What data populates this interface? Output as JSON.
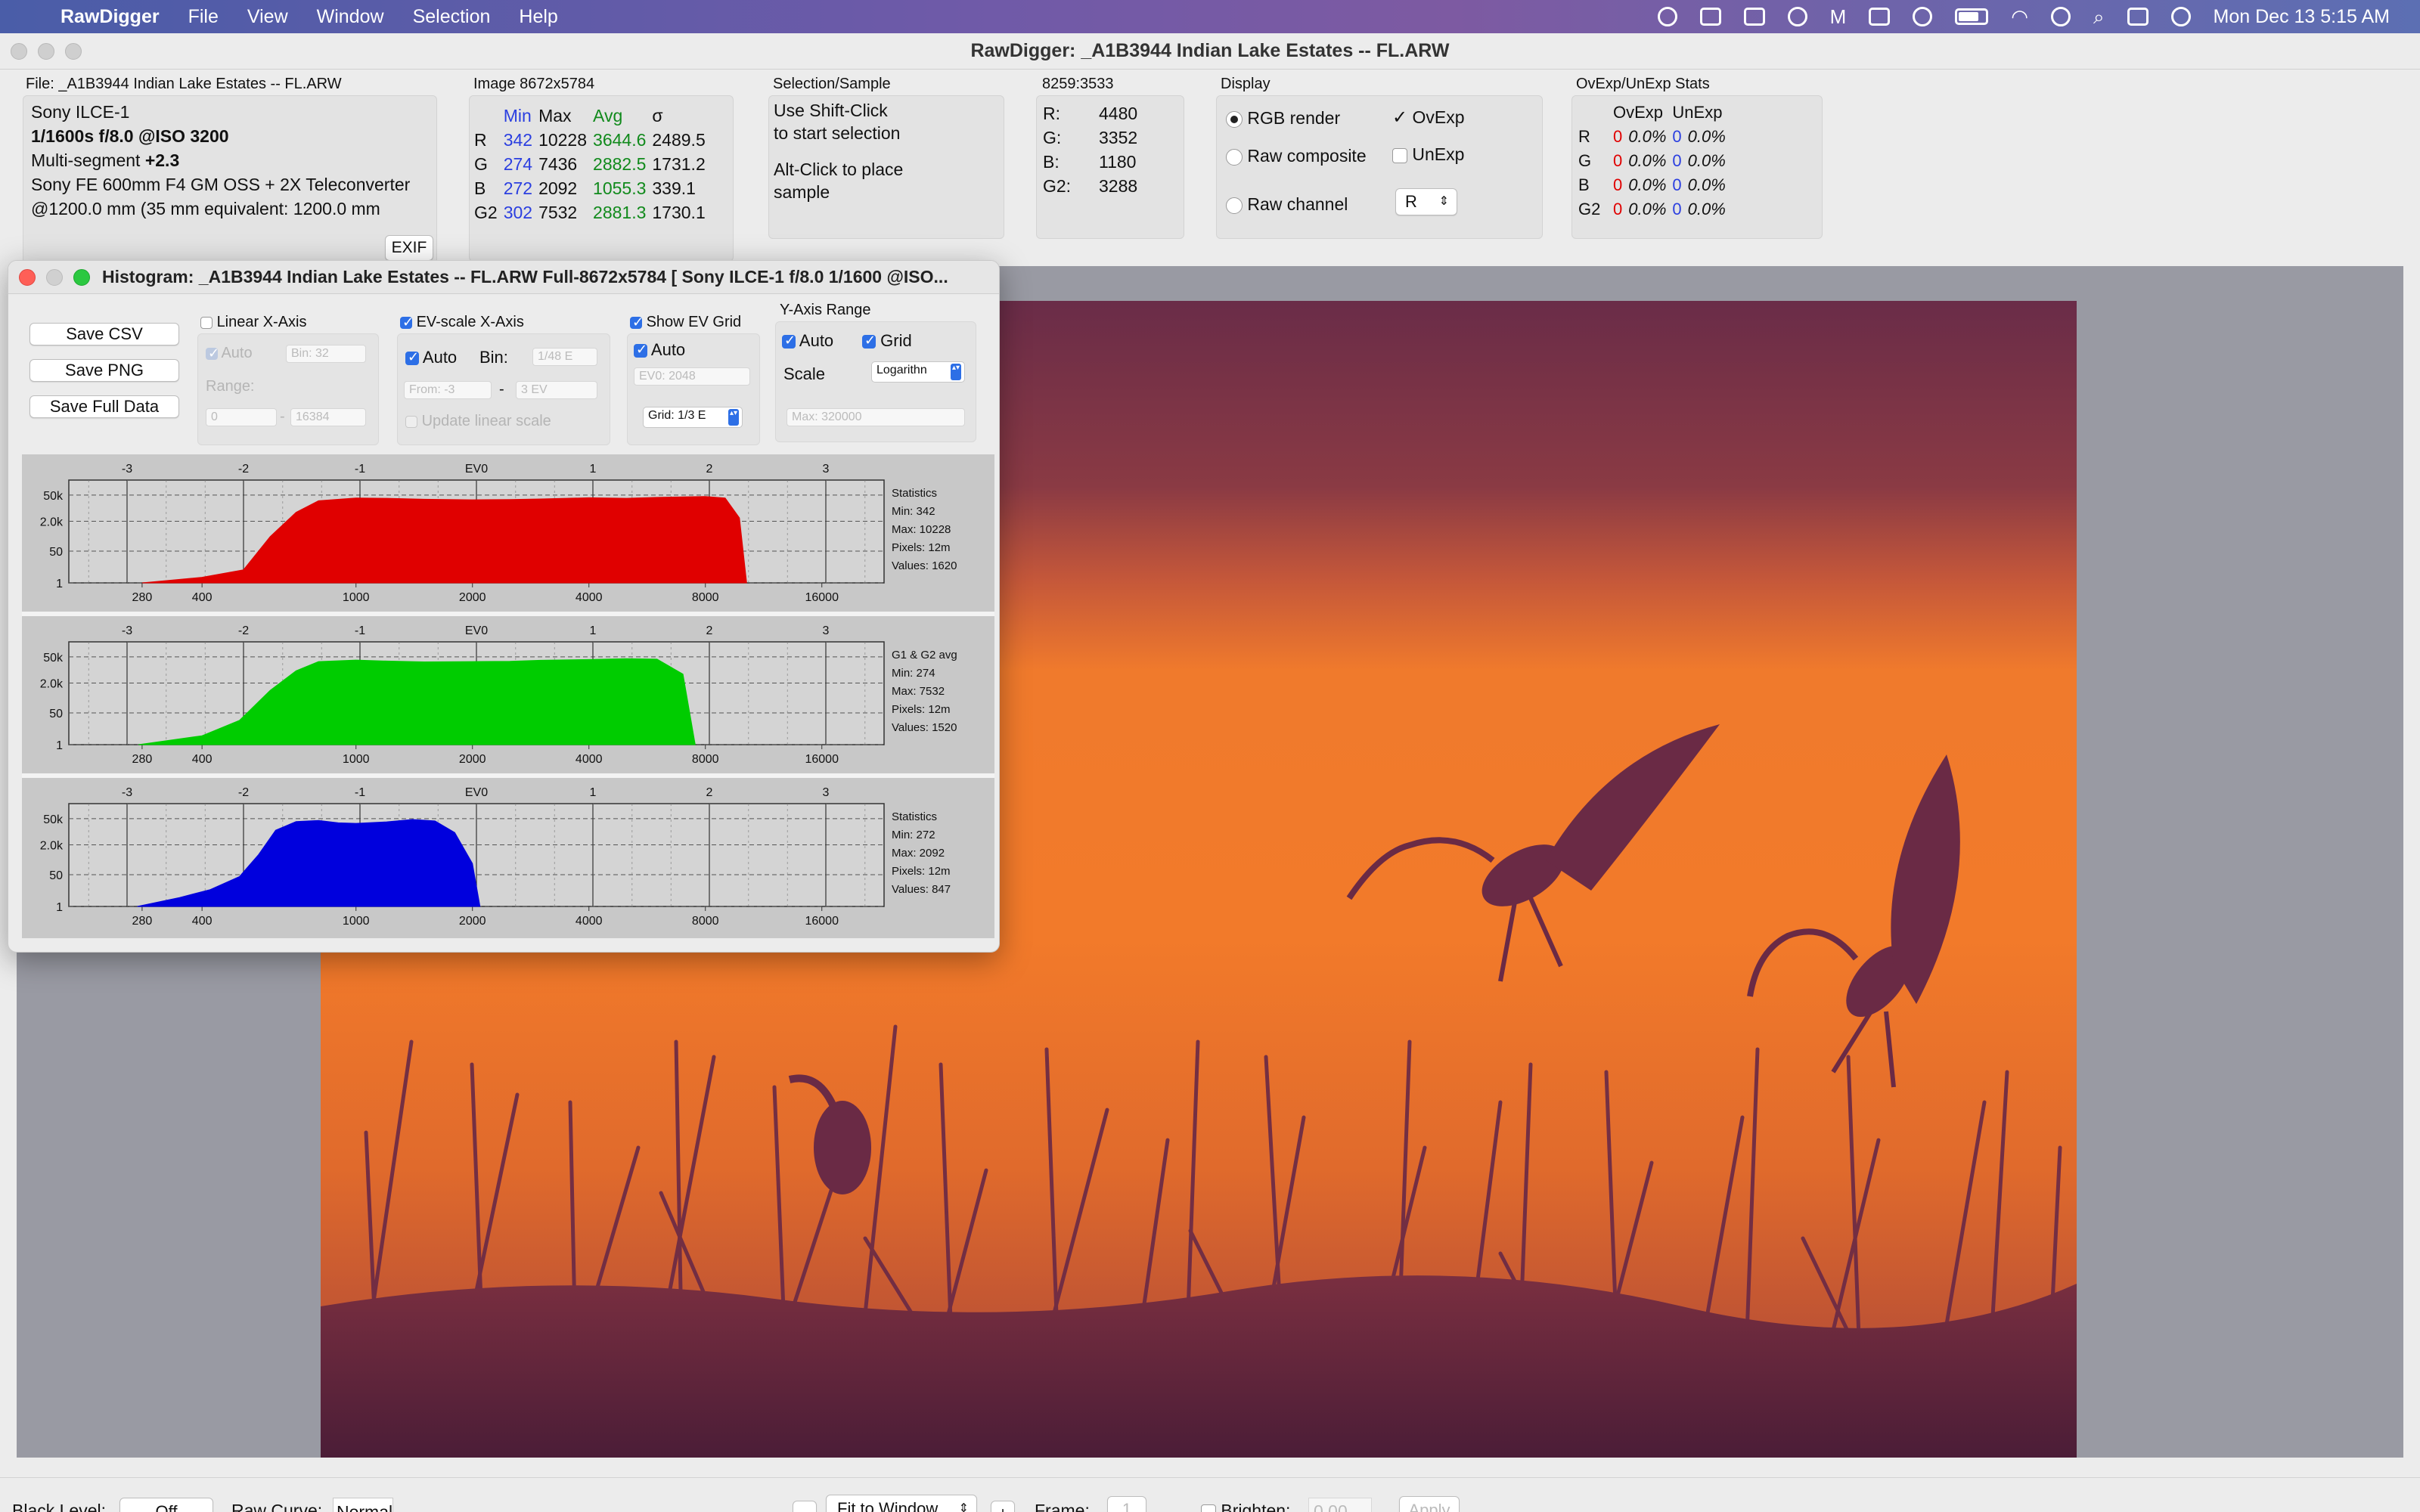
{
  "menubar": {
    "app_name": "RawDigger",
    "items": [
      "File",
      "View",
      "Window",
      "Selection",
      "Help"
    ],
    "clock": "Mon Dec 13  5:15 AM"
  },
  "window": {
    "title": "RawDigger: _A1B3944  Indian Lake Estates -- FL.ARW"
  },
  "file_panel": {
    "title": "File: _A1B3944  Indian Lake Estates -- FL.ARW",
    "camera": "Sony ILCE-1",
    "exposure": "1/1600s f/8.0 @ISO 3200",
    "segment_label": "Multi-segment ",
    "segment_value": "+2.3",
    "lens": "Sony FE 600mm F4 GM OSS + 2X Teleconverter",
    "focal": "@1200.0 mm (35 mm equivalent: 1200.0 mm",
    "exif_button": "EXIF"
  },
  "image_panel": {
    "title": "Image 8672x5784",
    "headers": [
      "Min",
      "Max",
      "Avg",
      "σ"
    ],
    "rows": [
      {
        "ch": "R",
        "min": "342",
        "max": "10228",
        "avg": "3644.6",
        "sd": "2489.5"
      },
      {
        "ch": "G",
        "min": "274",
        "max": "7436",
        "avg": "2882.5",
        "sd": "1731.2"
      },
      {
        "ch": "B",
        "min": "272",
        "max": "2092",
        "avg": "1055.3",
        "sd": "339.1"
      },
      {
        "ch": "G2",
        "min": "302",
        "max": "7532",
        "avg": "2881.3",
        "sd": "1730.1"
      }
    ]
  },
  "selection_panel": {
    "title": "Selection/Sample",
    "line1": "Use Shift-Click",
    "line2": "to start selection",
    "line3": "Alt-Click to place",
    "line4": "sample"
  },
  "sample_panel": {
    "title": "8259:3533",
    "rows": [
      {
        "label": "R:",
        "value": "4480"
      },
      {
        "label": "G:",
        "value": "3352"
      },
      {
        "label": "B:",
        "value": "1180"
      },
      {
        "label": "G2:",
        "value": "3288"
      }
    ]
  },
  "display_panel": {
    "title": "Display",
    "rgb_render": "RGB render",
    "raw_composite": "Raw composite",
    "raw_channel": "Raw channel",
    "ovexp": "OvExp",
    "unexp": "UnExp",
    "channel_select": "R"
  },
  "ovexp_panel": {
    "title": "OvExp/UnExp Stats",
    "headers": [
      "OvExp",
      "UnExp"
    ],
    "rows": [
      {
        "ch": "R",
        "ov_n": "0",
        "ov_p": "0.0%",
        "un_n": "0",
        "un_p": "0.0%"
      },
      {
        "ch": "G",
        "ov_n": "0",
        "ov_p": "0.0%",
        "un_n": "0",
        "un_p": "0.0%"
      },
      {
        "ch": "B",
        "ov_n": "0",
        "ov_p": "0.0%",
        "un_n": "0",
        "un_p": "0.0%"
      },
      {
        "ch": "G2",
        "ov_n": "0",
        "ov_p": "0.0%",
        "un_n": "0",
        "un_p": "0.0%"
      }
    ]
  },
  "histogram": {
    "title": "Histogram: _A1B3944  Indian Lake Estates -- FL.ARW Full-8672x5784 [ Sony ILCE-1 f/8.0 1/1600 @ISO...",
    "save_csv": "Save CSV",
    "save_png": "Save PNG",
    "save_full": "Save Full Data",
    "linear_x": "Linear X-Axis",
    "auto": "Auto",
    "bin_linear": "Bin: 32",
    "range": "Range:",
    "range_from": "0",
    "range_to": "16384",
    "ev_scale": "EV-scale X-Axis",
    "bin": "Bin:",
    "bin_ev": "1/48 E",
    "from": "From: -3",
    "to": "3 EV",
    "update_linear": "Update linear scale",
    "show_ev_grid": "Show EV Grid",
    "ev0_field": "EV0: 2048",
    "grid_select": "Grid: 1/3 E",
    "yaxis_title": "Y-Axis Range",
    "grid": "Grid",
    "scale": "Scale",
    "scale_select": "Logarithn",
    "ymax_field": "Max: 320000",
    "dash": "-"
  },
  "chart_data": [
    {
      "type": "area",
      "name": "R",
      "x_scale": "log2 (EV)",
      "top_ticks": [
        "-3",
        "-2",
        "-1",
        "EV0",
        "1",
        "2",
        "3"
      ],
      "bottom_ticks": [
        "280",
        "400",
        "1000",
        "2000",
        "4000",
        "8000",
        "16000"
      ],
      "y_ticks": [
        "50k",
        "2.0k",
        "50",
        "1"
      ],
      "x": [
        280,
        400,
        512,
        600,
        700,
        800,
        1000,
        1200,
        1500,
        2000,
        2500,
        3000,
        4000,
        5000,
        6000,
        7000,
        8000,
        9000,
        9800,
        10228
      ],
      "y": [
        1,
        2,
        5,
        300,
        6000,
        25000,
        35000,
        34000,
        30000,
        28000,
        29000,
        31000,
        36000,
        34000,
        38000,
        40000,
        42000,
        35000,
        3000,
        1
      ],
      "color": "#e00000",
      "stats_title": "Statistics",
      "stats": [
        "Min: 342",
        "Max: 10228",
        "Pixels: 12m",
        "Values: 1620"
      ]
    },
    {
      "type": "area",
      "name": "G",
      "x_scale": "log2 (EV)",
      "top_ticks": [
        "-3",
        "-2",
        "-1",
        "EV0",
        "1",
        "2",
        "3"
      ],
      "bottom_ticks": [
        "280",
        "400",
        "1000",
        "2000",
        "4000",
        "8000",
        "16000"
      ],
      "y_ticks": [
        "50k",
        "2.0k",
        "50",
        "1"
      ],
      "x": [
        274,
        400,
        500,
        600,
        700,
        800,
        1000,
        1200,
        1500,
        2000,
        2500,
        3000,
        4000,
        5000,
        6000,
        7000,
        7532
      ],
      "y": [
        1,
        3,
        20,
        800,
        9000,
        28000,
        34000,
        30000,
        27000,
        28000,
        29000,
        33000,
        36000,
        40000,
        38000,
        6000,
        1
      ],
      "color": "#00cc00",
      "stats_title": "G1 & G2 avg",
      "stats": [
        "Min: 274",
        "Max: 7532",
        "Pixels: 12m",
        "Values: 1520"
      ]
    },
    {
      "type": "area",
      "name": "B",
      "x_scale": "log2 (EV)",
      "top_ticks": [
        "-3",
        "-2",
        "-1",
        "EV0",
        "1",
        "2",
        "3"
      ],
      "bottom_ticks": [
        "280",
        "400",
        "1000",
        "2000",
        "4000",
        "8000",
        "16000"
      ],
      "y_ticks": [
        "50k",
        "2.0k",
        "50",
        "1"
      ],
      "x": [
        272,
        350,
        420,
        500,
        560,
        620,
        700,
        800,
        900,
        1000,
        1200,
        1400,
        1600,
        1800,
        2000,
        2092
      ],
      "y": [
        1,
        3,
        8,
        40,
        600,
        12000,
        35000,
        40000,
        30000,
        28000,
        34000,
        45000,
        38000,
        9000,
        200,
        1
      ],
      "color": "#0000dd",
      "stats_title": "Statistics",
      "stats": [
        "Min: 272",
        "Max: 2092",
        "Pixels: 12m",
        "Values: 847"
      ]
    }
  ],
  "bottombar": {
    "black_level": "Black Level:",
    "black_level_value": "Off",
    "raw_curve": "Raw Curve:",
    "raw_curve_value": "Normal",
    "minus": "-",
    "fit": "Fit to Window",
    "plus": "+",
    "frame": "Frame:",
    "frame_value": "1",
    "brighten": "Brighten:",
    "brighten_value": "0.00",
    "apply": "Apply"
  }
}
